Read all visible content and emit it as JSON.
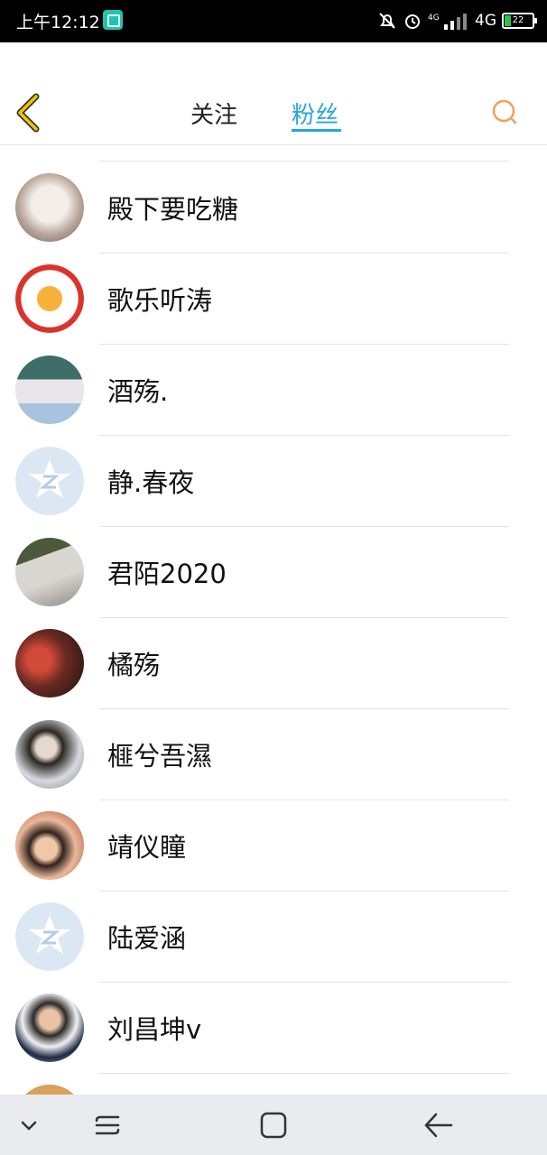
{
  "status_bar": {
    "time": "上午12:12",
    "network": "4G",
    "battery": "22"
  },
  "header": {
    "tabs": [
      {
        "label": "关注"
      },
      {
        "label": "粉丝"
      }
    ],
    "active_tab": "粉丝"
  },
  "fans": [
    {
      "name": "殿下要吃糖"
    },
    {
      "name": "歌乐听涛"
    },
    {
      "name": "酒殇."
    },
    {
      "name": "静.春夜"
    },
    {
      "name": "君陌2020"
    },
    {
      "name": "橘殇"
    },
    {
      "name": "榧兮吾濕"
    },
    {
      "name": "靖仪瞳"
    },
    {
      "name": "陆爱涵"
    },
    {
      "name": "刘昌坤v"
    }
  ],
  "colors": {
    "accent": "#29a6d8",
    "search": "#f0a05a",
    "back": "#e6b800"
  }
}
